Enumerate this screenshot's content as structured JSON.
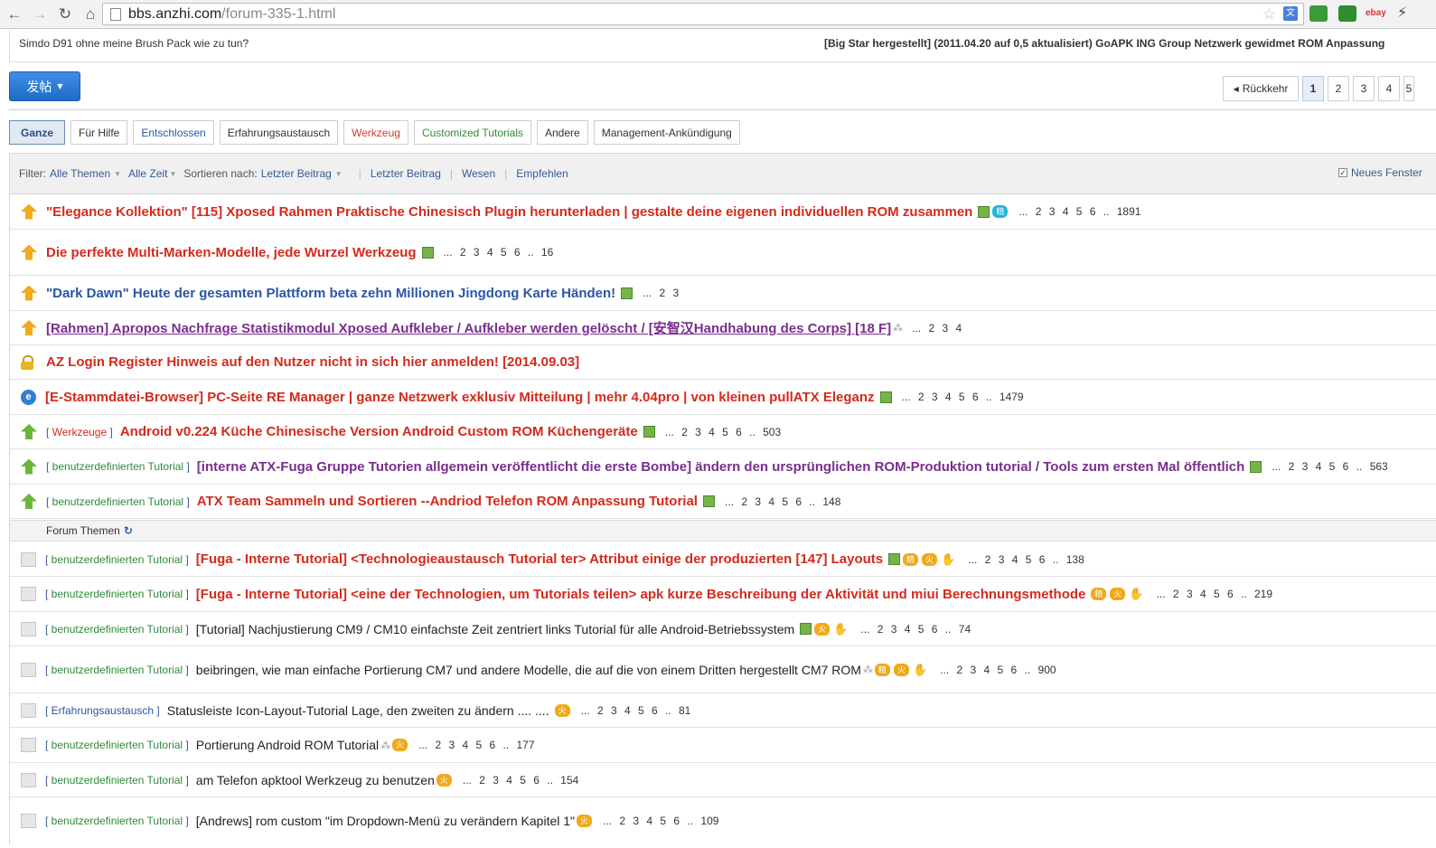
{
  "browser": {
    "url_domain": "bbs.anzhi.com",
    "url_path": "/forum-335-1.html",
    "ext_ebay": "ebay"
  },
  "ticker": {
    "left": "Simdo D91 ohne meine Brush Pack wie zu tun?",
    "right": "[Big Star hergestellt] (2011.04.20 auf 0,5 aktualisiert) GoAPK ING Group Netzwerk gewidmet ROM Anpassung"
  },
  "post_button": "发帖",
  "pager": {
    "back": "Rückkehr",
    "pages": [
      "1",
      "2",
      "3",
      "4",
      "5"
    ]
  },
  "tabs": [
    "Ganze",
    "Für Hilfe",
    "Entschlossen",
    "Erfahrungsaustausch",
    "Werkzeug",
    "Customized Tutorials",
    "Andere",
    "Management-Ankündigung"
  ],
  "filter": {
    "label": "Filter:",
    "all_topics": "Alle Themen",
    "all_time": "Alle Zeit",
    "sort_label": "Sortieren nach:",
    "sort_value": "Letzter Beitrag",
    "last_post": "Letzter Beitrag",
    "essence": "Wesen",
    "recommend": "Empfehlen",
    "new_window": "Neues Fenster"
  },
  "section_label": "Forum Themen",
  "threads": [
    {
      "tag": "",
      "title": "\"Elegance Kollektion\" [115] Xposed Rahmen Praktische Chinesisch Plugin herunterladen | gestalte deine eigenen individuellen ROM zusammen",
      "badge": "精",
      "pages": "... 2 3 4 5 6 .. 1891"
    },
    {
      "tag": "",
      "title": "Die perfekte Multi-Marken-Modelle, jede Wurzel Werkzeug",
      "pages": "... 2 3 4 5 6 .. 16"
    },
    {
      "tag": "",
      "title": "\"Dark Dawn\" Heute der gesamten Plattform beta zehn Millionen Jingdong Karte Händen!",
      "pages": "... 2 3"
    },
    {
      "tag": "",
      "title": "[Rahmen] Apropos Nachfrage Statistikmodul Xposed Aufkleber / Aufkleber werden gelöscht / [安智汉Handhabung des Corps] [18 F]",
      "pages": "... 2 3 4"
    },
    {
      "tag": "",
      "title": "AZ Login Register Hinweis auf den Nutzer nicht in sich hier anmelden! [2014.09.03]",
      "pages": ""
    },
    {
      "tag": "",
      "title": "[E-Stammdatei-Browser] PC-Seite RE Manager | ganze Netzwerk exklusiv Mitteilung | mehr 4.04pro | von kleinen pullATX Eleganz",
      "pages": "... 2 3 4 5 6 .. 1479"
    },
    {
      "tag": "Werkzeuge",
      "title": "Android v0.224 Küche Chinesische Version Android Custom ROM Küchengeräte",
      "pages": "... 2 3 4 5 6 .. 503"
    },
    {
      "tag": "benutzerdefinierten Tutorial",
      "title": "[interne ATX-Fuga Gruppe Tutorien allgemein veröffentlicht die erste Bombe] ändern den ursprünglichen ROM-Produktion tutorial / Tools zum ersten Mal öffentlich",
      "pages": "... 2 3 4 5 6 .. 563"
    },
    {
      "tag": "benutzerdefinierten Tutorial",
      "title": "ATX Team Sammeln und Sortieren --Andriod Telefon ROM Anpassung Tutorial",
      "pages": "... 2 3 4 5 6 .. 148"
    },
    {
      "tag": "benutzerdefinierten Tutorial",
      "title": "[Fuga - Interne Tutorial] <Technologieaustausch Tutorial ter> Attribut einige der produzierten [147] Layouts",
      "b1": "精",
      "b2": "火",
      "pages": "... 2 3 4 5 6 .. 138"
    },
    {
      "tag": "benutzerdefinierten Tutorial",
      "title": "[Fuga - Interne Tutorial] <eine der Technologien, um Tutorials teilen> apk kurze Beschreibung der Aktivität und miui Berechnungsmethode",
      "b1": "精",
      "b2": "火",
      "pages": "... 2 3 4 5 6 .. 219"
    },
    {
      "tag": "benutzerdefinierten Tutorial",
      "title": "[Tutorial] Nachjustierung CM9 / CM10 einfachste Zeit zentriert links Tutorial für alle Android-Betriebssystem",
      "b2": "火",
      "pages": "... 2 3 4 5 6 .. 74"
    },
    {
      "tag": "benutzerdefinierten Tutorial",
      "title": "beibringen, wie man einfache Portierung CM7 und andere Modelle, die auf die von einem Dritten hergestellt CM7 ROM",
      "b1": "精",
      "b2": "火",
      "pages": "... 2 3 4 5 6 .. 900"
    },
    {
      "tag": "Erfahrungsaustausch",
      "title": "Statusleiste Icon-Layout-Tutorial Lage, den zweiten zu ändern .... ....",
      "b2": "火",
      "pages": "... 2 3 4 5 6 .. 81"
    },
    {
      "tag": "benutzerdefinierten Tutorial",
      "title": "Portierung Android ROM Tutorial",
      "b2": "火",
      "pages": "... 2 3 4 5 6 .. 177"
    },
    {
      "tag": "benutzerdefinierten Tutorial",
      "title": "am Telefon apktool Werkzeug zu benutzen",
      "b2": "火",
      "pages": "... 2 3 4 5 6 .. 154"
    },
    {
      "tag": "benutzerdefinierten Tutorial",
      "title": "[Andrews] rom custom \"im Dropdown-Menü zu verändern Kapitel 1\"",
      "b2": "火",
      "pages": "... 2 3 4 5 6 .. 109"
    }
  ]
}
